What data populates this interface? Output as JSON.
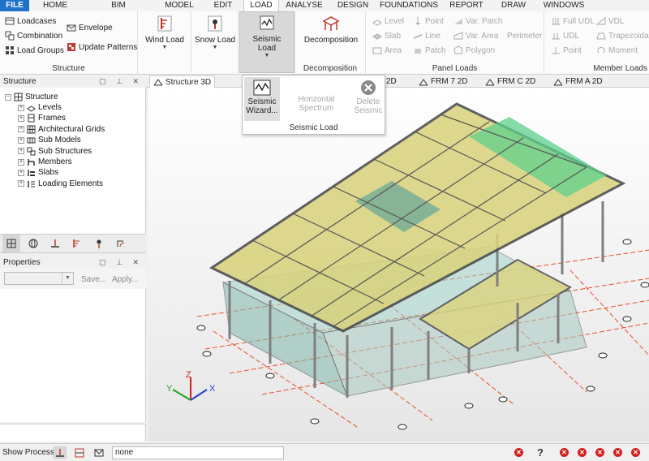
{
  "menu": {
    "items": [
      "FILE",
      "HOME",
      "BIM INTEGRATION",
      "MODEL",
      "EDIT",
      "LOAD",
      "ANALYSE",
      "DESIGN",
      "FOUNDATIONS",
      "REPORT",
      "DRAW",
      "WINDOWS"
    ],
    "active": "LOAD"
  },
  "ribbon": {
    "structure": {
      "title": "Structure",
      "loadcases": "Loadcases",
      "combination": "Combination",
      "load_groups": "Load Groups",
      "envelope": "Envelope",
      "update_patterns": "Update Patterns"
    },
    "wind_load": "Wind Load",
    "snow_load": "Snow Load",
    "seismic_load": [
      "Seismic",
      "Load"
    ],
    "decomposition": {
      "button": "Decomposition",
      "title": "Decomposition"
    },
    "panel_loads": {
      "title": "Panel Loads",
      "level": "Level",
      "slab": "Slab",
      "area": "Area",
      "point": "Point",
      "line": "Line",
      "patch": "Patch",
      "var_patch": "Var. Patch",
      "var_area": "Var. Area",
      "polygon": "Polygon",
      "perimeter": "Perimeter"
    },
    "member_loads": {
      "title": "Member Loads",
      "full_udl": "Full UDL",
      "udl": "UDL",
      "point": "Point",
      "vdl": "VDL",
      "trapezoidal": "Trapezoidal",
      "moment": "Moment"
    }
  },
  "seismic_popup": {
    "wizard": [
      "Seismic",
      "Wizard..."
    ],
    "horizontal_spectrum": "Horizontal Spectrum",
    "delete": [
      "Delete",
      "Seismic"
    ],
    "title": "Seismic Load"
  },
  "structure_panel": {
    "title": "Structure",
    "root": "Structure",
    "items": [
      "Levels",
      "Frames",
      "Architectural Grids",
      "Sub Models",
      "Sub Structures",
      "Members",
      "Slabs",
      "Loading Elements"
    ]
  },
  "properties_panel": {
    "title": "Properties",
    "save": "Save...",
    "apply": "Apply..."
  },
  "tabs": [
    "Structure 3D",
    "2D",
    "FRM 7 2D",
    "FRM C 2D",
    "FRM A 2D"
  ],
  "active_tab": "Structure 3D",
  "axes": {
    "x": "X",
    "y": "Y",
    "z": "Z"
  },
  "status": {
    "label": "Show Process",
    "field": "none",
    "help": "?"
  },
  "colors": {
    "accent": "#1e72c7",
    "error": "#d21f1f",
    "slab_yellow": "#d8d27a",
    "slab_green": "#5ed08c"
  }
}
